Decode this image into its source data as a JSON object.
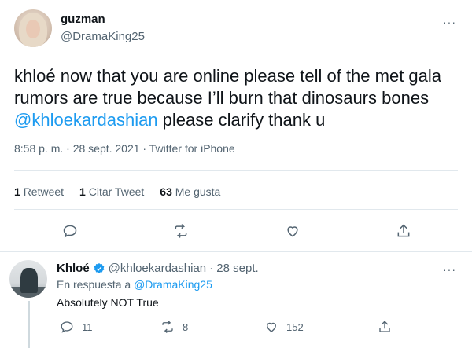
{
  "tweet": {
    "author_name": "guzman",
    "author_handle": "@DramaKing25",
    "text_before": "khloé now that you are online please tell of the met gala rumors are true because I’ll burn that dinosaurs bones ",
    "mention": "@khloekardashian",
    "text_after": " please clarify thank u",
    "timestamp": "8:58 p. m. · 28 sept. 2021 · Twitter for iPhone",
    "stats": {
      "retweets_count": "1",
      "retweets_label": "Retweet",
      "quotes_count": "1",
      "quotes_label": "Citar Tweet",
      "likes_count": "63",
      "likes_label": "Me gusta"
    },
    "more": "···"
  },
  "reply": {
    "author_name": "Khloé",
    "author_handle": "@khloekardashian",
    "date": "· 28 sept.",
    "replying_to_prefix": "En respuesta a ",
    "replying_to_handle": "@DramaKing25",
    "text": "Absolutely NOT True",
    "replies": "11",
    "retweets": "8",
    "likes": "152",
    "more": "···"
  },
  "colors": {
    "accent": "#1d9bf0",
    "muted": "#536471",
    "text": "#0f1419",
    "divider": "#e1e8ed"
  },
  "icons": [
    "reply-icon",
    "retweet-icon",
    "like-icon",
    "share-icon",
    "verified-badge-icon",
    "more-options-icon"
  ]
}
